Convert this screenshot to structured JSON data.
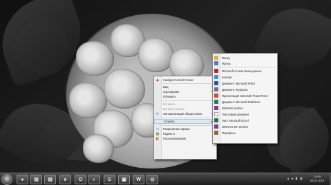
{
  "context_menu": {
    "items": [
      {
        "label": "Catalyst Control Center",
        "icon": "catalyst-icon"
      },
      {
        "label": "Вид",
        "submenu": true
      },
      {
        "label": "Сортировка",
        "submenu": true
      },
      {
        "label": "Обновить"
      },
      {
        "label": "Вставить",
        "disabled": true
      },
      {
        "label": "Вставить ярлык",
        "disabled": true
      },
      {
        "label": "Синхронизация общих папок",
        "submenu": true,
        "icon": "sync-icon"
      },
      {
        "label": "Создать",
        "submenu": true,
        "highlighted": true
      },
      {
        "label": "Разрешение экрана",
        "icon": "display-icon"
      },
      {
        "label": "Гаджеты",
        "icon": "gadgets-icon"
      },
      {
        "label": "Персонализация",
        "icon": "personalize-icon"
      }
    ]
  },
  "new_submenu": {
    "items": [
      {
        "label": "Папку",
        "icon": "folder-icon",
        "color": "#d9b24a"
      },
      {
        "label": "Ярлык",
        "icon": "shortcut-icon",
        "color": "#5a7db5"
      },
      {
        "label": "Microsoft Access База данных",
        "icon": "access-icon",
        "color": "#a83232"
      },
      {
        "label": "Контакт",
        "icon": "contact-icon",
        "color": "#4a8fc9"
      },
      {
        "label": "Документ Microsoft Word",
        "icon": "word-icon",
        "color": "#2b5797"
      },
      {
        "label": "Документ Журнала",
        "icon": "journal-icon",
        "color": "#6d6d9e"
      },
      {
        "label": "Презентация Microsoft PowerPoint",
        "icon": "powerpoint-icon",
        "color": "#c8502b"
      },
      {
        "label": "Документ Microsoft Publisher",
        "icon": "publisher-icon",
        "color": "#1f7a6c"
      },
      {
        "label": "WinRAR archive",
        "icon": "winrar-icon",
        "color": "#7c3c8a"
      },
      {
        "label": "Текстовый документ",
        "icon": "text-doc-icon",
        "color": "#9a9a9a"
      },
      {
        "label": "Лист Microsoft Excel",
        "icon": "excel-icon",
        "color": "#217346"
      },
      {
        "label": "WinRAR ZIP archive",
        "icon": "winrar-zip-icon",
        "color": "#7c3c8a"
      },
      {
        "label": "Портфель",
        "icon": "briefcase-icon",
        "color": "#8a6a3a"
      }
    ]
  },
  "taskbar": {
    "buttons": [
      {
        "icon": "media-player-icon",
        "glyph": "●"
      },
      {
        "icon": "folder-icon",
        "glyph": "▤"
      },
      {
        "icon": "browser-icon",
        "glyph": "e"
      },
      {
        "icon": "opera-icon",
        "glyph": "O"
      },
      {
        "icon": "app-icon",
        "glyph": "◐"
      },
      {
        "icon": "skype-icon",
        "glyph": "S"
      },
      {
        "icon": "media-icon",
        "glyph": "▣"
      },
      {
        "icon": "word-icon",
        "glyph": "W"
      },
      {
        "icon": "app-icon",
        "glyph": "◎"
      }
    ],
    "tray": "▴ ◂ ▮ ◍",
    "time": "13:09",
    "date": "05.01.2016"
  }
}
